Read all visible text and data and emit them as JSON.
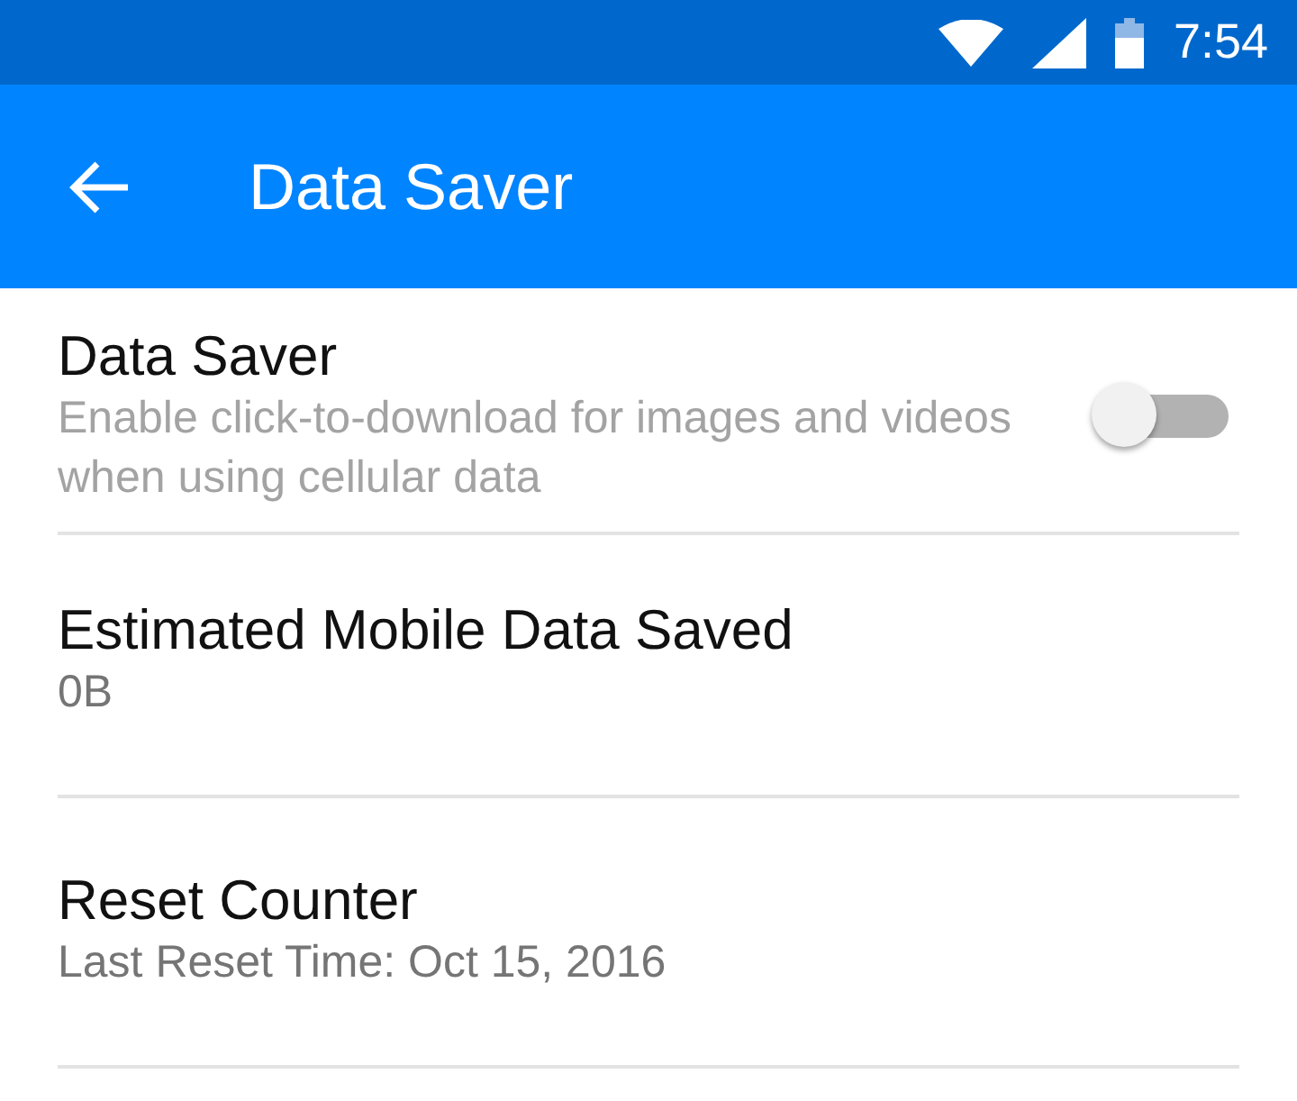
{
  "status_bar": {
    "time": "7:54"
  },
  "app_bar": {
    "title": "Data Saver"
  },
  "settings": [
    {
      "kind": "toggle",
      "title": "Data Saver",
      "summary": "Enable click-to-download for images and videos when using cellular data",
      "on": false
    },
    {
      "kind": "info",
      "title": "Estimated Mobile Data Saved",
      "summary": "0B"
    },
    {
      "kind": "info",
      "title": "Reset Counter",
      "summary": "Last Reset Time: Oct 15, 2016"
    }
  ]
}
